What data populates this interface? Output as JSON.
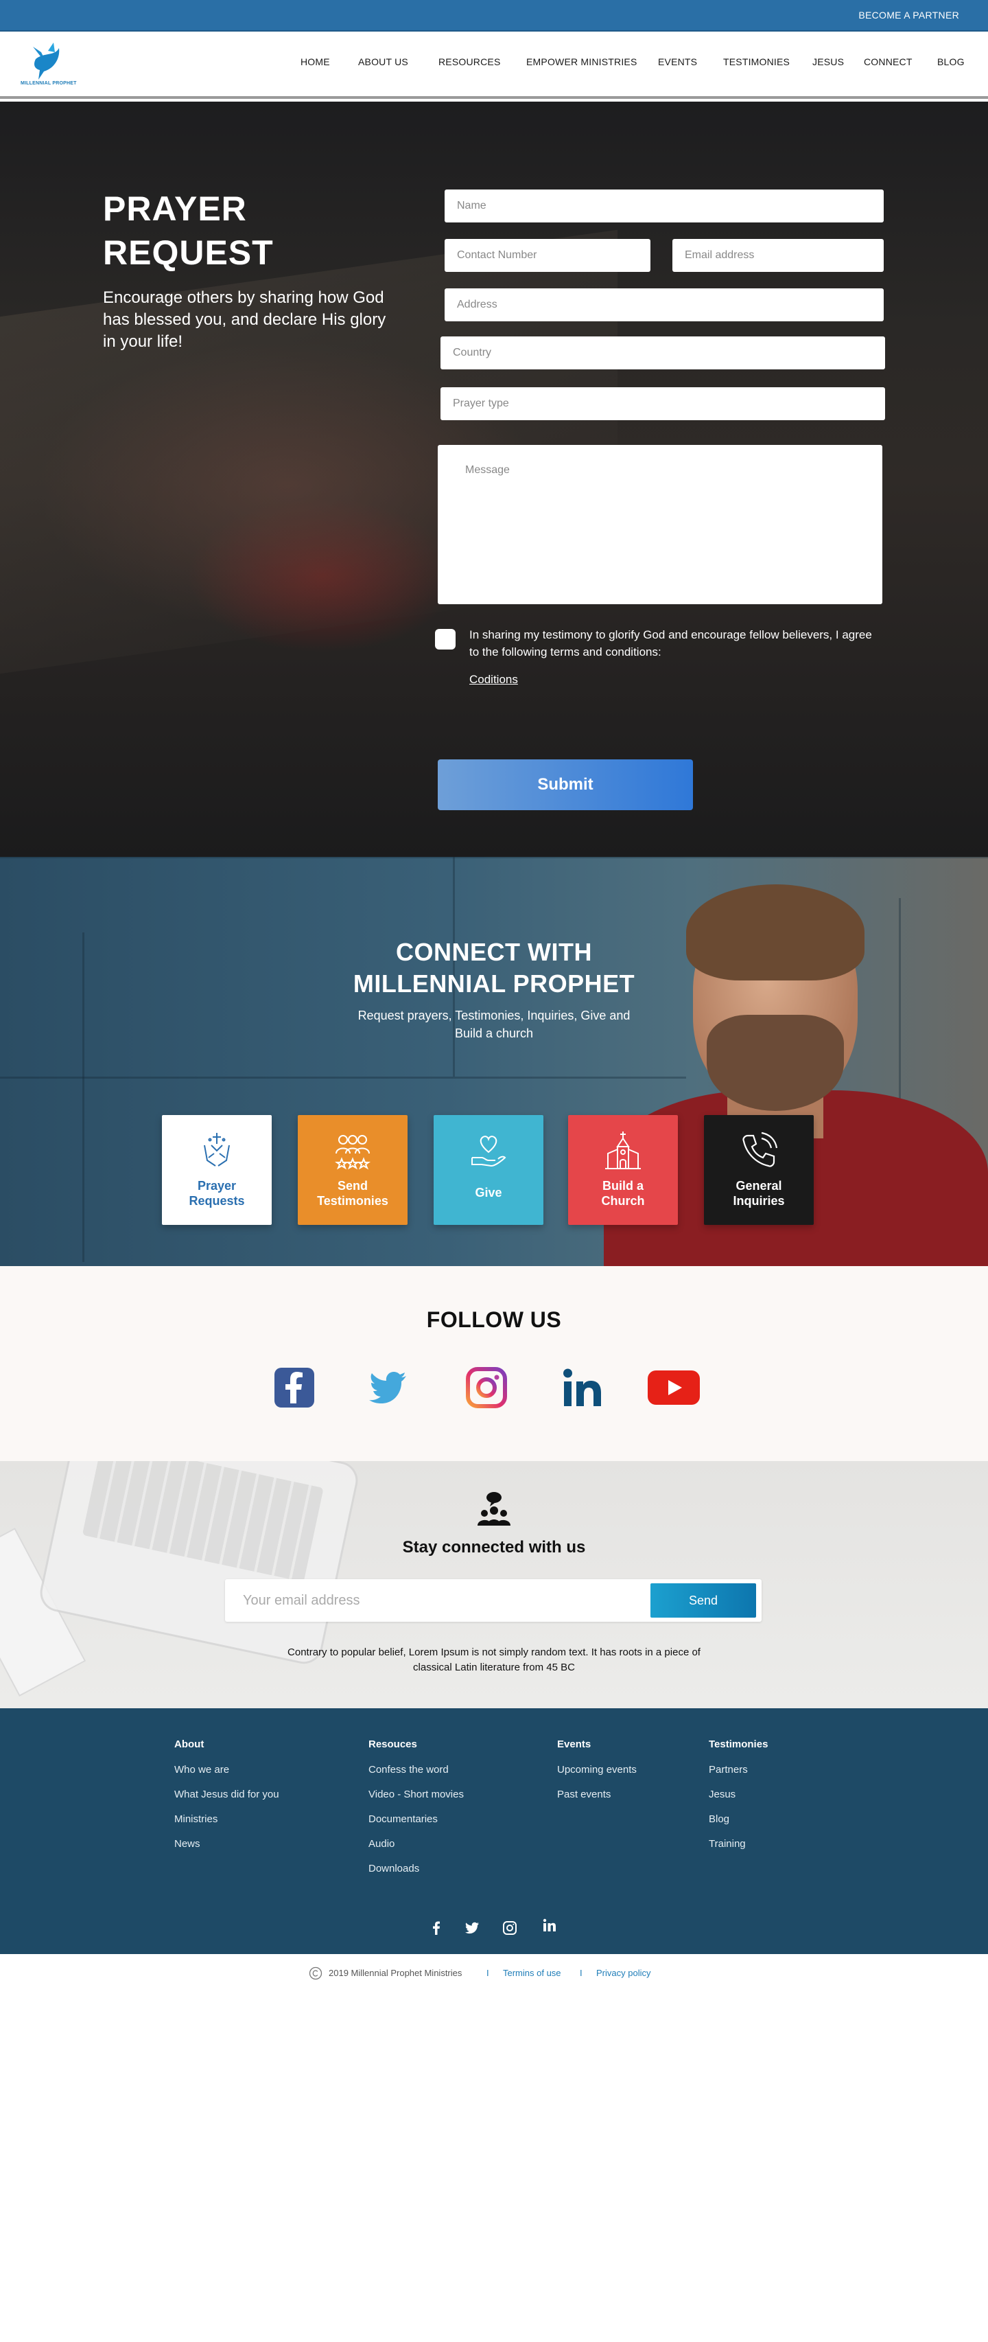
{
  "topbar": {
    "partner_label": "BECOME A PARTNER"
  },
  "header": {
    "logo_text": "MILLENNIAL PROPHET",
    "nav": [
      "HOME",
      "ABOUT US",
      "RESOURCES",
      "EMPOWER MINISTRIES",
      "EVENTS",
      "TESTIMONIES",
      "JESUS",
      "CONNECT",
      "BLOG"
    ]
  },
  "prayer": {
    "title_line1": "PRAYER",
    "title_line2": "REQUEST",
    "subtitle": "Encourage others by sharing how God has blessed you, and declare His glory in your life!",
    "placeholders": {
      "name": "Name",
      "contact": "Contact Number",
      "email": "Email address",
      "address": "Address",
      "country": "Country",
      "prayer_type": "Prayer type",
      "message": "Message"
    },
    "terms_text": "In sharing my testimony to glorify God and encourage fellow believers, I agree to the following terms and conditions:",
    "conditions_link": "Coditions",
    "submit_label": "Submit"
  },
  "connect": {
    "title_line1": "CONNECT WITH",
    "title_line2": "MILLENNIAL PROPHET",
    "subtitle": "Request prayers, Testimonies, Inquiries, Give and Build a church",
    "tiles": [
      {
        "label_line1": "Prayer",
        "label_line2": "Requests",
        "icon": "praying-hands-icon",
        "bg": "#ffffff",
        "fg": "#2a6fb0"
      },
      {
        "label_line1": "Send",
        "label_line2": "Testimonies",
        "icon": "group-stars-icon",
        "bg": "#e98e2a",
        "fg": "#ffffff"
      },
      {
        "label_line1": "Give",
        "label_line2": "",
        "icon": "heart-hand-icon",
        "bg": "#40b5d1",
        "fg": "#ffffff"
      },
      {
        "label_line1": "Build a",
        "label_line2": "Church",
        "icon": "church-icon",
        "bg": "#e5464a",
        "fg": "#ffffff"
      },
      {
        "label_line1": "General",
        "label_line2": "Inquiries",
        "icon": "phone-icon",
        "bg": "#1a1a1a",
        "fg": "#ffffff"
      }
    ]
  },
  "follow": {
    "title": "FOLLOW US",
    "icons": [
      "facebook-icon",
      "twitter-icon",
      "instagram-icon",
      "linkedin-icon",
      "youtube-icon"
    ]
  },
  "newsletter": {
    "title": "Stay connected with us",
    "placeholder": "Your email address",
    "send_label": "Send",
    "body": "Contrary to popular belief, Lorem Ipsum is not simply random text. It has roots in a piece of classical Latin literature from 45 BC"
  },
  "footer": {
    "columns": [
      {
        "heading": "About",
        "links": [
          "Who we are",
          "What Jesus did for you",
          "Ministries",
          "News"
        ]
      },
      {
        "heading": "Resouces",
        "links": [
          "Confess the word",
          "Video - Short movies",
          "Documentaries",
          "Audio",
          "Downloads"
        ]
      },
      {
        "heading": "Events",
        "links": [
          "Upcoming events",
          "Past events"
        ]
      },
      {
        "heading": "Testimonies",
        "links": [
          "Partners",
          "Jesus",
          "Blog",
          "Training"
        ]
      }
    ],
    "social_icons": [
      "facebook-icon",
      "twitter-icon",
      "instagram-icon",
      "linkedin-icon"
    ]
  },
  "bottom": {
    "copyright": "2019 Millennial Prophet Ministries",
    "separator": "I",
    "terms": "Termins of use",
    "privacy": "Privacy policy"
  },
  "colors": {
    "brand_blue": "#2a6fa6",
    "footer_blue": "#1e4a66",
    "link_blue": "#1f7db8"
  }
}
